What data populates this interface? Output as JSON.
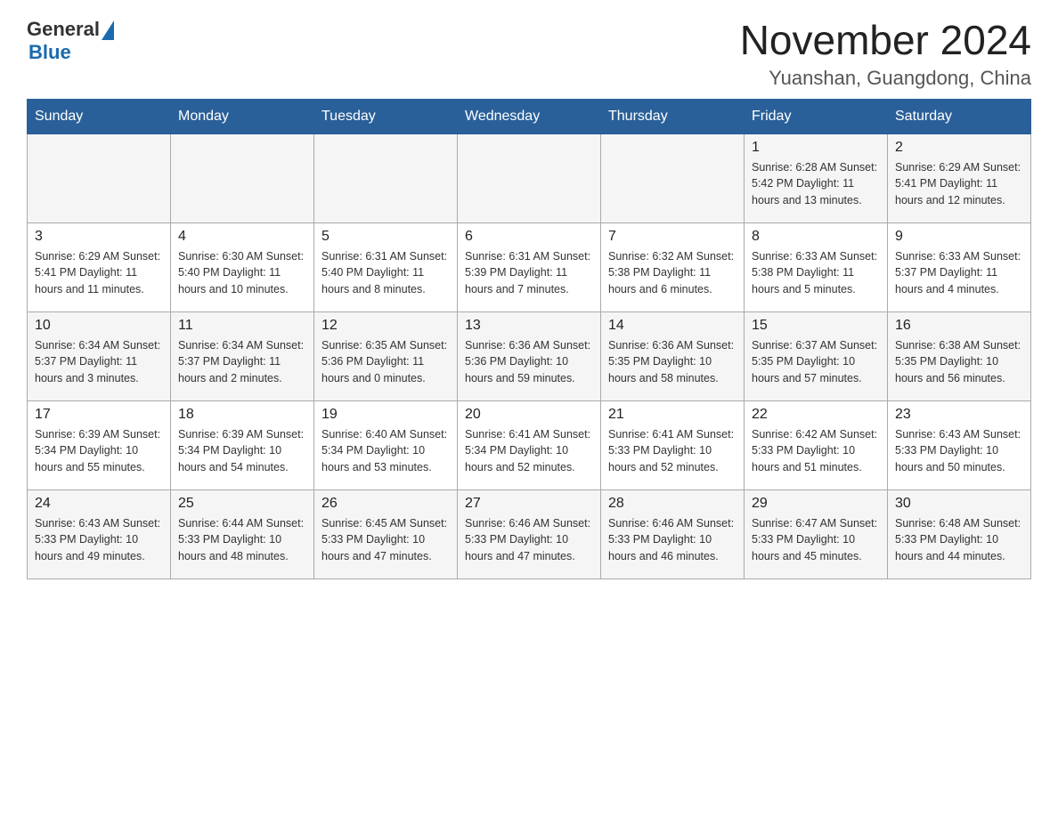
{
  "header": {
    "logo_general": "General",
    "logo_blue": "Blue",
    "month_year": "November 2024",
    "location": "Yuanshan, Guangdong, China"
  },
  "weekdays": [
    "Sunday",
    "Monday",
    "Tuesday",
    "Wednesday",
    "Thursday",
    "Friday",
    "Saturday"
  ],
  "weeks": [
    [
      {
        "day": "",
        "info": ""
      },
      {
        "day": "",
        "info": ""
      },
      {
        "day": "",
        "info": ""
      },
      {
        "day": "",
        "info": ""
      },
      {
        "day": "",
        "info": ""
      },
      {
        "day": "1",
        "info": "Sunrise: 6:28 AM\nSunset: 5:42 PM\nDaylight: 11 hours\nand 13 minutes."
      },
      {
        "day": "2",
        "info": "Sunrise: 6:29 AM\nSunset: 5:41 PM\nDaylight: 11 hours\nand 12 minutes."
      }
    ],
    [
      {
        "day": "3",
        "info": "Sunrise: 6:29 AM\nSunset: 5:41 PM\nDaylight: 11 hours\nand 11 minutes."
      },
      {
        "day": "4",
        "info": "Sunrise: 6:30 AM\nSunset: 5:40 PM\nDaylight: 11 hours\nand 10 minutes."
      },
      {
        "day": "5",
        "info": "Sunrise: 6:31 AM\nSunset: 5:40 PM\nDaylight: 11 hours\nand 8 minutes."
      },
      {
        "day": "6",
        "info": "Sunrise: 6:31 AM\nSunset: 5:39 PM\nDaylight: 11 hours\nand 7 minutes."
      },
      {
        "day": "7",
        "info": "Sunrise: 6:32 AM\nSunset: 5:38 PM\nDaylight: 11 hours\nand 6 minutes."
      },
      {
        "day": "8",
        "info": "Sunrise: 6:33 AM\nSunset: 5:38 PM\nDaylight: 11 hours\nand 5 minutes."
      },
      {
        "day": "9",
        "info": "Sunrise: 6:33 AM\nSunset: 5:37 PM\nDaylight: 11 hours\nand 4 minutes."
      }
    ],
    [
      {
        "day": "10",
        "info": "Sunrise: 6:34 AM\nSunset: 5:37 PM\nDaylight: 11 hours\nand 3 minutes."
      },
      {
        "day": "11",
        "info": "Sunrise: 6:34 AM\nSunset: 5:37 PM\nDaylight: 11 hours\nand 2 minutes."
      },
      {
        "day": "12",
        "info": "Sunrise: 6:35 AM\nSunset: 5:36 PM\nDaylight: 11 hours\nand 0 minutes."
      },
      {
        "day": "13",
        "info": "Sunrise: 6:36 AM\nSunset: 5:36 PM\nDaylight: 10 hours\nand 59 minutes."
      },
      {
        "day": "14",
        "info": "Sunrise: 6:36 AM\nSunset: 5:35 PM\nDaylight: 10 hours\nand 58 minutes."
      },
      {
        "day": "15",
        "info": "Sunrise: 6:37 AM\nSunset: 5:35 PM\nDaylight: 10 hours\nand 57 minutes."
      },
      {
        "day": "16",
        "info": "Sunrise: 6:38 AM\nSunset: 5:35 PM\nDaylight: 10 hours\nand 56 minutes."
      }
    ],
    [
      {
        "day": "17",
        "info": "Sunrise: 6:39 AM\nSunset: 5:34 PM\nDaylight: 10 hours\nand 55 minutes."
      },
      {
        "day": "18",
        "info": "Sunrise: 6:39 AM\nSunset: 5:34 PM\nDaylight: 10 hours\nand 54 minutes."
      },
      {
        "day": "19",
        "info": "Sunrise: 6:40 AM\nSunset: 5:34 PM\nDaylight: 10 hours\nand 53 minutes."
      },
      {
        "day": "20",
        "info": "Sunrise: 6:41 AM\nSunset: 5:34 PM\nDaylight: 10 hours\nand 52 minutes."
      },
      {
        "day": "21",
        "info": "Sunrise: 6:41 AM\nSunset: 5:33 PM\nDaylight: 10 hours\nand 52 minutes."
      },
      {
        "day": "22",
        "info": "Sunrise: 6:42 AM\nSunset: 5:33 PM\nDaylight: 10 hours\nand 51 minutes."
      },
      {
        "day": "23",
        "info": "Sunrise: 6:43 AM\nSunset: 5:33 PM\nDaylight: 10 hours\nand 50 minutes."
      }
    ],
    [
      {
        "day": "24",
        "info": "Sunrise: 6:43 AM\nSunset: 5:33 PM\nDaylight: 10 hours\nand 49 minutes."
      },
      {
        "day": "25",
        "info": "Sunrise: 6:44 AM\nSunset: 5:33 PM\nDaylight: 10 hours\nand 48 minutes."
      },
      {
        "day": "26",
        "info": "Sunrise: 6:45 AM\nSunset: 5:33 PM\nDaylight: 10 hours\nand 47 minutes."
      },
      {
        "day": "27",
        "info": "Sunrise: 6:46 AM\nSunset: 5:33 PM\nDaylight: 10 hours\nand 47 minutes."
      },
      {
        "day": "28",
        "info": "Sunrise: 6:46 AM\nSunset: 5:33 PM\nDaylight: 10 hours\nand 46 minutes."
      },
      {
        "day": "29",
        "info": "Sunrise: 6:47 AM\nSunset: 5:33 PM\nDaylight: 10 hours\nand 45 minutes."
      },
      {
        "day": "30",
        "info": "Sunrise: 6:48 AM\nSunset: 5:33 PM\nDaylight: 10 hours\nand 44 minutes."
      }
    ]
  ]
}
